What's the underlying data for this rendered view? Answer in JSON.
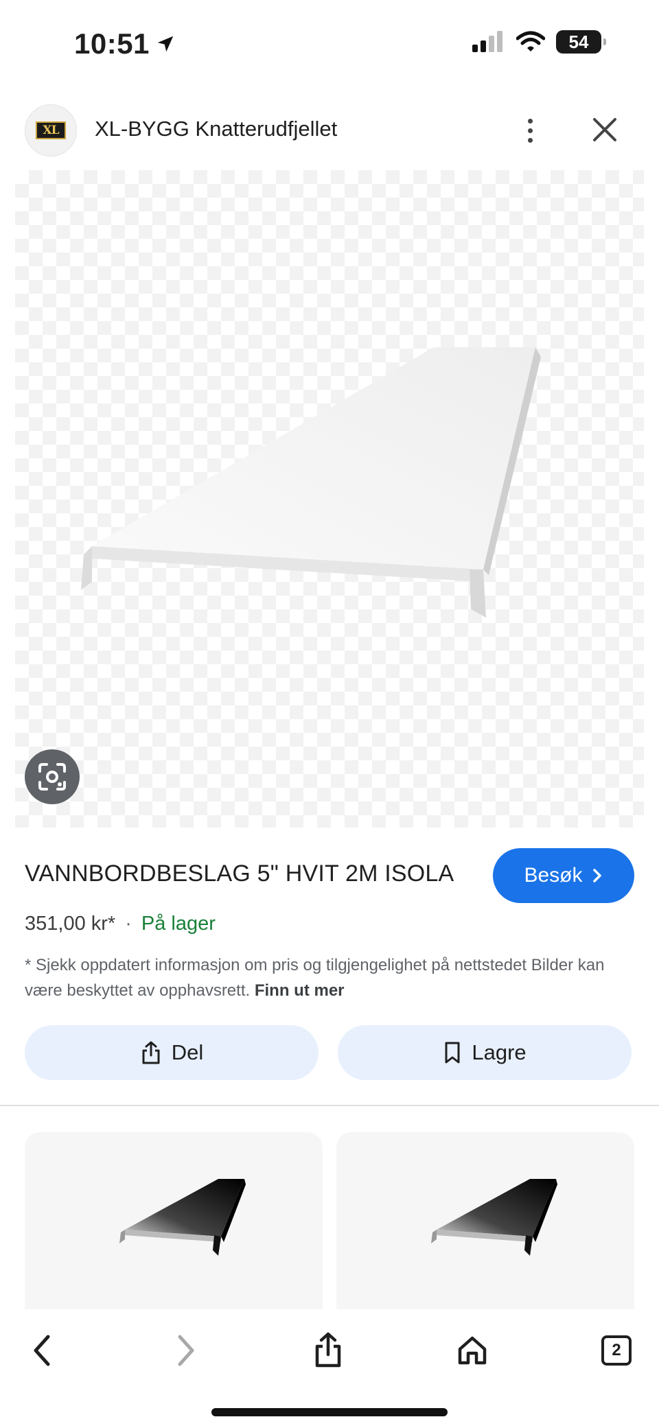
{
  "status_bar": {
    "time": "10:51",
    "battery": "54"
  },
  "header": {
    "site_name": "XL-BYGG Knatterudfjellet",
    "logo_text": "XL",
    "icons": [
      "more-vert-icon",
      "close-icon"
    ]
  },
  "product": {
    "title": "VANNBORDBESLAG 5\" HVIT 2M ISOLA",
    "visit_label": "Besøk",
    "price": "351,00 kr*",
    "separator": "·",
    "stock": "På lager",
    "disclaimer": "* Sjekk oppdatert informasjon om pris og tilgjengelighet på nettstedet Bilder kan være beskyttet av opphavsrett.",
    "disclaimer_link": "Finn ut mer"
  },
  "actions": {
    "share_label": "Del",
    "save_label": "Lagre"
  },
  "toolbar": {
    "tabs_count": "2",
    "icons": [
      "back-icon",
      "forward-icon",
      "share-icon",
      "home-icon",
      "tabs-icon"
    ]
  },
  "colors": {
    "accent": "#1a73e8",
    "stock_green": "#188038",
    "chip_bg": "#e8f0fe"
  }
}
